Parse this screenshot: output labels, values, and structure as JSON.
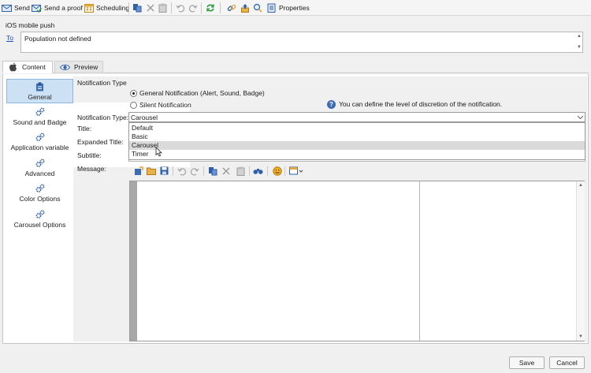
{
  "toolbar": {
    "send_label": "Send",
    "send_proof_label": "Send a proof",
    "scheduling_label": "Scheduling",
    "properties_label": "Properties"
  },
  "header": {
    "title": "iOS mobile push",
    "to_label": "To",
    "to_value": "Population not defined"
  },
  "tabs": [
    {
      "label": "Content"
    },
    {
      "label": "Preview"
    }
  ],
  "sidebar": {
    "items": [
      {
        "label": "General"
      },
      {
        "label": "Sound and Badge"
      },
      {
        "label": "Application variable"
      },
      {
        "label": "Advanced"
      },
      {
        "label": "Color Options"
      },
      {
        "label": "Carousel Options"
      }
    ]
  },
  "form": {
    "section_title": "Notification Type",
    "radio_general": "General Notification (Alert, Sound, Badge)",
    "radio_silent": "Silent Notification",
    "info_text": "You can define the level of discretion of the notification.",
    "type_label": "Notification Type:",
    "type_value": "Carousel",
    "type_options": [
      "Default",
      "Basic",
      "Carousel",
      "Timer"
    ],
    "title_label": "Title:",
    "expanded_title_label": "Expanded Title:",
    "subtitle_label": "Subtitle:",
    "message_label": "Message:"
  },
  "footer": {
    "save_label": "Save",
    "cancel_label": "Cancel"
  },
  "colors": {
    "accent": "#1a4fb5",
    "active_sidebar": "#cde1f5"
  }
}
